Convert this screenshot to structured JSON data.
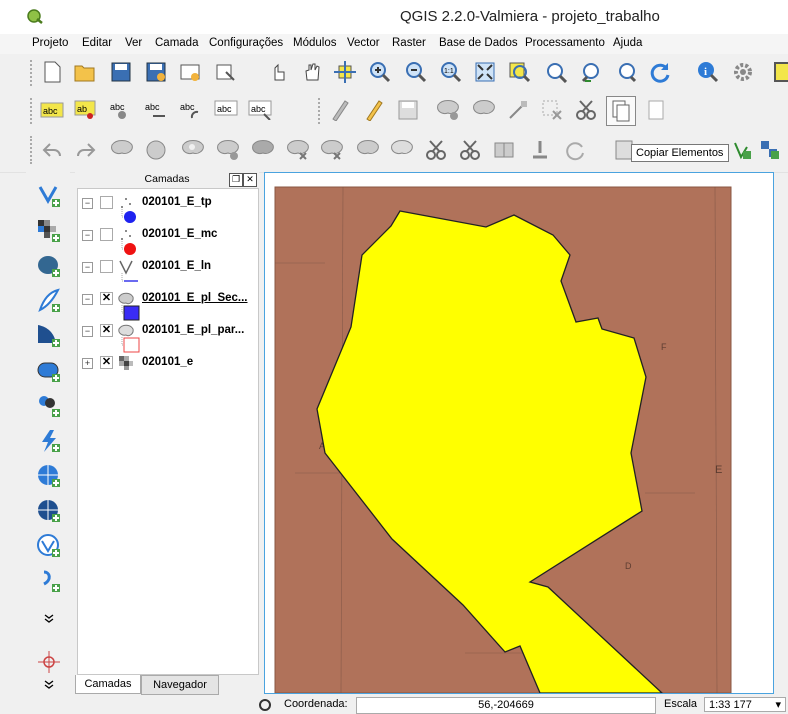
{
  "window": {
    "title": "QGIS 2.2.0-Valmiera - projeto_trabalho"
  },
  "menu": [
    "Projeto",
    "Editar",
    "Ver",
    "Camada",
    "Configurações",
    "Módulos",
    "Vector",
    "Raster",
    "Base de Dados",
    "Processamento",
    "Ajuda"
  ],
  "tooltip": "Copiar Elementos",
  "layers_panel": {
    "title": "Camadas",
    "layers": [
      {
        "name": "020101_E_tp",
        "checked": false,
        "symbol": "blue-point"
      },
      {
        "name": "020101_E_mc",
        "checked": false,
        "symbol": "red-point"
      },
      {
        "name": "020101_E_ln",
        "checked": false,
        "symbol": "line"
      },
      {
        "name": "020101_E_pl_Sec...",
        "checked": true,
        "symbol": "blue-fill"
      },
      {
        "name": "020101_E_pl_par...",
        "checked": true,
        "symbol": "outline"
      },
      {
        "name": "020101_e",
        "checked": true,
        "symbol": "raster"
      }
    ],
    "tabs": [
      "Camadas",
      "Navegador"
    ]
  },
  "map_labels": [
    "A",
    "F",
    "D",
    "E"
  ],
  "status": {
    "coord_label": "Coordenada:",
    "coord_value": "56,-204669",
    "scale_label": "Escala",
    "scale_value": "1:33 177"
  },
  "colors": {
    "polygon_fill": "#ffff00",
    "map_background": "#b0725a",
    "selected_layer_fill": "#3a2cf5"
  }
}
